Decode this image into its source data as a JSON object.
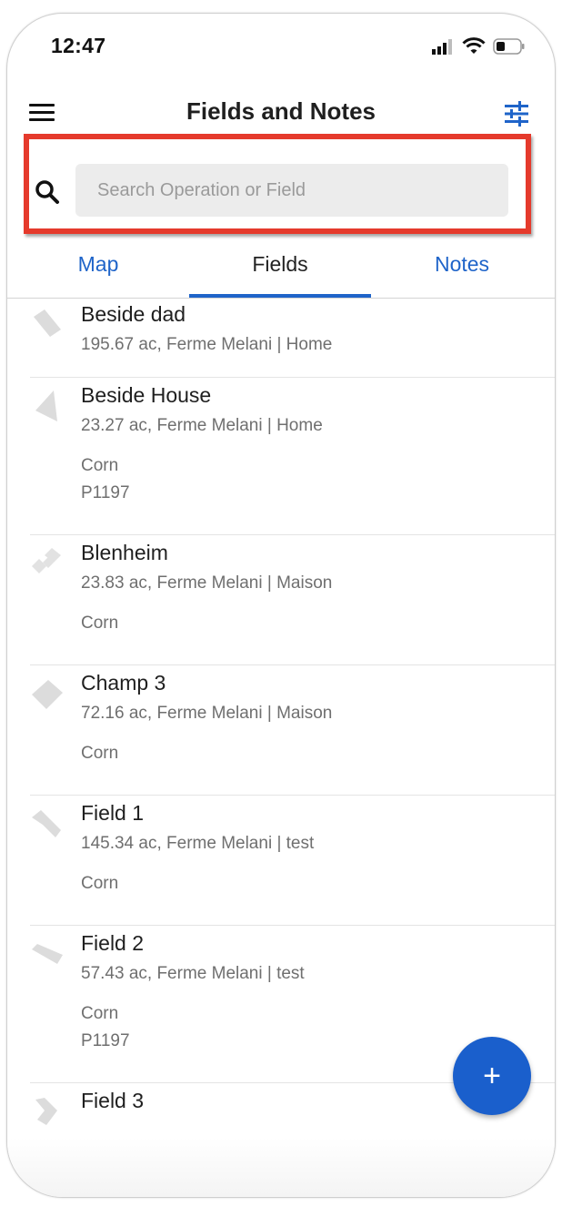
{
  "status_bar": {
    "time": "12:47"
  },
  "header": {
    "title": "Fields and Notes"
  },
  "search": {
    "placeholder": "Search Operation or Field",
    "value": ""
  },
  "tabs": [
    {
      "label": "Map",
      "active": false
    },
    {
      "label": "Fields",
      "active": true
    },
    {
      "label": "Notes",
      "active": false
    }
  ],
  "fields": [
    {
      "name": "Beside dad",
      "meta": "195.67 ac, Ferme Melani | Home",
      "crops": []
    },
    {
      "name": "Beside House",
      "meta": "23.27 ac, Ferme Melani | Home",
      "crops": [
        "Corn",
        "P1197"
      ]
    },
    {
      "name": "Blenheim",
      "meta": "23.83 ac, Ferme Melani | Maison",
      "crops": [
        "Corn"
      ]
    },
    {
      "name": "Champ 3",
      "meta": "72.16 ac, Ferme Melani | Maison",
      "crops": [
        "Corn"
      ]
    },
    {
      "name": "Field 1",
      "meta": "145.34 ac, Ferme Melani | test",
      "crops": [
        "Corn"
      ]
    },
    {
      "name": "Field 2",
      "meta": "57.43 ac, Ferme Melani | test",
      "crops": [
        "Corn",
        "P1197"
      ]
    },
    {
      "name": "Field 3",
      "meta": "",
      "crops": []
    }
  ],
  "fab": {
    "label": "+"
  },
  "colors": {
    "accent": "#1f64c9",
    "highlight": "#e53a2c",
    "fab": "#1a5fcc"
  },
  "icons": [
    "menu-icon",
    "filter-sliders-icon",
    "search-icon",
    "field-shape-icon",
    "plus-icon",
    "signal-icon",
    "wifi-icon",
    "battery-icon"
  ]
}
